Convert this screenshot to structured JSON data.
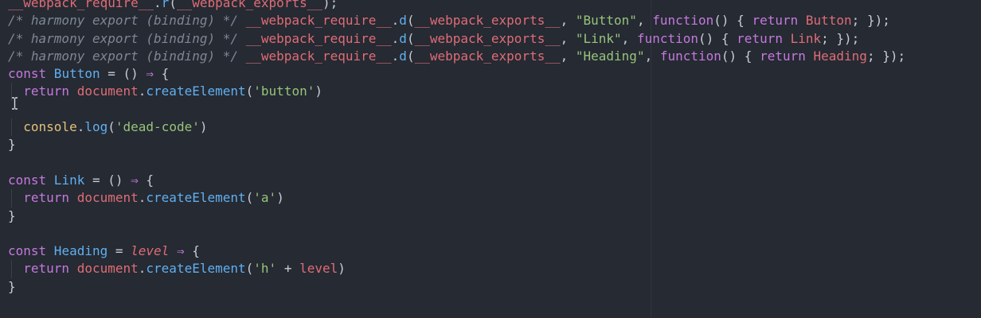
{
  "editor": {
    "lines": [
      [
        {
          "text": "__webpack_require__",
          "cls": "t-ident"
        },
        {
          "text": ".",
          "cls": "t-punct"
        },
        {
          "text": "r",
          "cls": "t-fn"
        },
        {
          "text": "(",
          "cls": "t-punct"
        },
        {
          "text": "__webpack_exports__",
          "cls": "t-ident"
        },
        {
          "text": ");",
          "cls": "t-punct"
        }
      ],
      [
        {
          "text": "/* harmony export (binding) */ ",
          "cls": "t-comment"
        },
        {
          "text": "__webpack_require__",
          "cls": "t-ident"
        },
        {
          "text": ".",
          "cls": "t-punct"
        },
        {
          "text": "d",
          "cls": "t-fn"
        },
        {
          "text": "(",
          "cls": "t-punct"
        },
        {
          "text": "__webpack_exports__",
          "cls": "t-ident"
        },
        {
          "text": ", ",
          "cls": "t-punct"
        },
        {
          "text": "\"Button\"",
          "cls": "t-string"
        },
        {
          "text": ", ",
          "cls": "t-punct"
        },
        {
          "text": "function",
          "cls": "t-keyword"
        },
        {
          "text": "() { ",
          "cls": "t-punct"
        },
        {
          "text": "return",
          "cls": "t-keyword"
        },
        {
          "text": " Button",
          "cls": "t-ident"
        },
        {
          "text": "; });",
          "cls": "t-punct"
        }
      ],
      [
        {
          "text": "/* harmony export (binding) */ ",
          "cls": "t-comment"
        },
        {
          "text": "__webpack_require__",
          "cls": "t-ident"
        },
        {
          "text": ".",
          "cls": "t-punct"
        },
        {
          "text": "d",
          "cls": "t-fn"
        },
        {
          "text": "(",
          "cls": "t-punct"
        },
        {
          "text": "__webpack_exports__",
          "cls": "t-ident"
        },
        {
          "text": ", ",
          "cls": "t-punct"
        },
        {
          "text": "\"Link\"",
          "cls": "t-string"
        },
        {
          "text": ", ",
          "cls": "t-punct"
        },
        {
          "text": "function",
          "cls": "t-keyword"
        },
        {
          "text": "() { ",
          "cls": "t-punct"
        },
        {
          "text": "return",
          "cls": "t-keyword"
        },
        {
          "text": " Link",
          "cls": "t-ident"
        },
        {
          "text": "; });",
          "cls": "t-punct"
        }
      ],
      [
        {
          "text": "/* harmony export (binding) */ ",
          "cls": "t-comment"
        },
        {
          "text": "__webpack_require__",
          "cls": "t-ident"
        },
        {
          "text": ".",
          "cls": "t-punct"
        },
        {
          "text": "d",
          "cls": "t-fn"
        },
        {
          "text": "(",
          "cls": "t-punct"
        },
        {
          "text": "__webpack_exports__",
          "cls": "t-ident"
        },
        {
          "text": ", ",
          "cls": "t-punct"
        },
        {
          "text": "\"Heading\"",
          "cls": "t-string"
        },
        {
          "text": ", ",
          "cls": "t-punct"
        },
        {
          "text": "function",
          "cls": "t-keyword"
        },
        {
          "text": "() { ",
          "cls": "t-punct"
        },
        {
          "text": "return",
          "cls": "t-keyword"
        },
        {
          "text": " Heading",
          "cls": "t-ident"
        },
        {
          "text": "; });",
          "cls": "t-punct"
        }
      ],
      [
        {
          "text": "const",
          "cls": "t-keyword"
        },
        {
          "text": " Button",
          "cls": "t-fn"
        },
        {
          "text": " = () ",
          "cls": "t-punct"
        },
        {
          "text": "⇒",
          "cls": "t-keyword"
        },
        {
          "text": " {",
          "cls": "t-punct"
        }
      ],
      [
        {
          "text": "  ",
          "cls": "t-plain"
        },
        {
          "text": "return",
          "cls": "t-keyword"
        },
        {
          "text": " document",
          "cls": "t-ident"
        },
        {
          "text": ".",
          "cls": "t-punct"
        },
        {
          "text": "createElement",
          "cls": "t-fn"
        },
        {
          "text": "(",
          "cls": "t-punct"
        },
        {
          "text": "'button'",
          "cls": "t-string"
        },
        {
          "text": ")",
          "cls": "t-punct"
        }
      ],
      [],
      [
        {
          "text": "  ",
          "cls": "t-plain"
        },
        {
          "text": "console",
          "cls": "t-console"
        },
        {
          "text": ".",
          "cls": "t-punct"
        },
        {
          "text": "log",
          "cls": "t-fn"
        },
        {
          "text": "(",
          "cls": "t-punct"
        },
        {
          "text": "'dead-code'",
          "cls": "t-string"
        },
        {
          "text": ")",
          "cls": "t-punct"
        }
      ],
      [
        {
          "text": "}",
          "cls": "t-punct"
        }
      ],
      [],
      [
        {
          "text": "const",
          "cls": "t-keyword"
        },
        {
          "text": " Link",
          "cls": "t-fn"
        },
        {
          "text": " = () ",
          "cls": "t-punct"
        },
        {
          "text": "⇒",
          "cls": "t-keyword"
        },
        {
          "text": " {",
          "cls": "t-punct"
        }
      ],
      [
        {
          "text": "  ",
          "cls": "t-plain"
        },
        {
          "text": "return",
          "cls": "t-keyword"
        },
        {
          "text": " document",
          "cls": "t-ident"
        },
        {
          "text": ".",
          "cls": "t-punct"
        },
        {
          "text": "createElement",
          "cls": "t-fn"
        },
        {
          "text": "(",
          "cls": "t-punct"
        },
        {
          "text": "'a'",
          "cls": "t-string"
        },
        {
          "text": ")",
          "cls": "t-punct"
        }
      ],
      [
        {
          "text": "}",
          "cls": "t-punct"
        }
      ],
      [],
      [
        {
          "text": "const",
          "cls": "t-keyword"
        },
        {
          "text": " Heading",
          "cls": "t-fn"
        },
        {
          "text": " = ",
          "cls": "t-punct"
        },
        {
          "text": "level",
          "cls": "t-param"
        },
        {
          "text": " ",
          "cls": "t-punct"
        },
        {
          "text": "⇒",
          "cls": "t-keyword"
        },
        {
          "text": " {",
          "cls": "t-punct"
        }
      ],
      [
        {
          "text": "  ",
          "cls": "t-plain"
        },
        {
          "text": "return",
          "cls": "t-keyword"
        },
        {
          "text": " document",
          "cls": "t-ident"
        },
        {
          "text": ".",
          "cls": "t-punct"
        },
        {
          "text": "createElement",
          "cls": "t-fn"
        },
        {
          "text": "(",
          "cls": "t-punct"
        },
        {
          "text": "'h'",
          "cls": "t-string"
        },
        {
          "text": " + ",
          "cls": "t-punct"
        },
        {
          "text": "level",
          "cls": "t-ident"
        },
        {
          "text": ")",
          "cls": "t-punct"
        }
      ],
      [
        {
          "text": "}",
          "cls": "t-punct"
        }
      ]
    ],
    "indented_lines": [
      5,
      7,
      11,
      15
    ]
  },
  "colors": {
    "background": "#252a33",
    "keyword": "#c678dd",
    "identifier": "#e06c75",
    "function": "#61afef",
    "string": "#98c379",
    "comment": "#7f8794"
  },
  "icons": {
    "cursor": "ibeam-cursor-icon"
  }
}
